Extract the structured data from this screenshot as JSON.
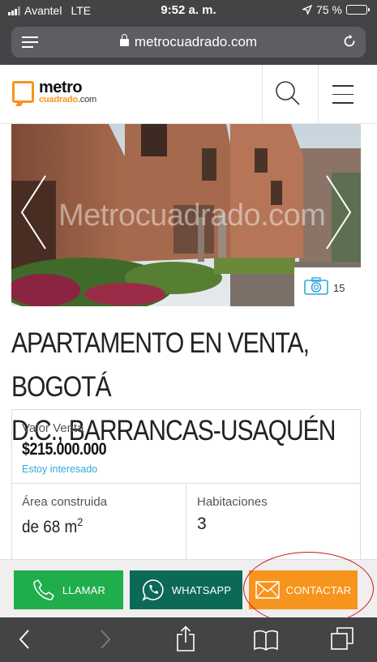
{
  "status_bar": {
    "carrier": "Avantel",
    "network": "LTE",
    "time": "9:52 a. m.",
    "battery_pct": "75 %",
    "battery_level": 0.75,
    "icons": [
      "signal-icon",
      "location-arrow-icon",
      "battery-icon"
    ]
  },
  "browser": {
    "url": "metrocuadrado.com",
    "icons": [
      "reader-menu-icon",
      "lock-icon",
      "reload-icon"
    ]
  },
  "site_header": {
    "logo_line1": "metro",
    "logo_line2": "cuadrado",
    "logo_suffix": ".com",
    "icons": [
      "search-icon",
      "hamburger-menu-icon"
    ]
  },
  "gallery": {
    "watermark": "Metrocuadrado.com",
    "photo_count": "15",
    "icons": [
      "chevron-left-icon",
      "chevron-right-icon",
      "camera-icon"
    ]
  },
  "listing": {
    "title_line1": "APARTAMENTO EN VENTA, BOGOTÁ",
    "title_line2": "D.C., BARRANCAS-USAQUÉN",
    "price_label": "Valor Venta",
    "price": "$215.000.000",
    "interest_link": "Estoy interesado",
    "area_label": "Área construida",
    "area_value": "de 68 m",
    "area_unit_sup": "2",
    "rooms_label": "Habitaciones",
    "rooms_value": "3"
  },
  "actions": {
    "call_label": "LLAMAR",
    "whatsapp_label": "WHATSAPP",
    "contact_label": "CONTACTAR",
    "colors": {
      "call": "#1fae4b",
      "whatsapp": "#0d6957",
      "contact": "#f7941d"
    }
  },
  "toolbar": {
    "icons": [
      "back-icon",
      "forward-icon",
      "share-icon",
      "bookmarks-icon",
      "tabs-icon"
    ]
  },
  "colors": {
    "brand_orange": "#f7941d",
    "link_blue": "#2ea9d9",
    "chrome": "#444446"
  }
}
